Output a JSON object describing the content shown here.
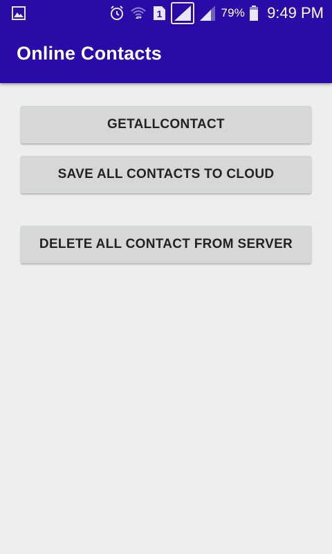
{
  "status_bar": {
    "battery_percent": "79%",
    "time": "9:49 PM",
    "sim_label": "1",
    "icons": [
      "gallery-icon",
      "alarm-icon",
      "wifi-icon",
      "sim-icon",
      "signal-icon",
      "signal-icon",
      "battery-icon"
    ]
  },
  "app_bar": {
    "title": "Online Contacts",
    "background_color": "#2a0ba8"
  },
  "buttons": {
    "get_all_contact": "GETALLCONTACT",
    "save_all_contacts": "SAVE ALL CONTACTS TO CLOUD",
    "delete_all_contact": "DELETE ALL CONTACT FROM SERVER"
  }
}
